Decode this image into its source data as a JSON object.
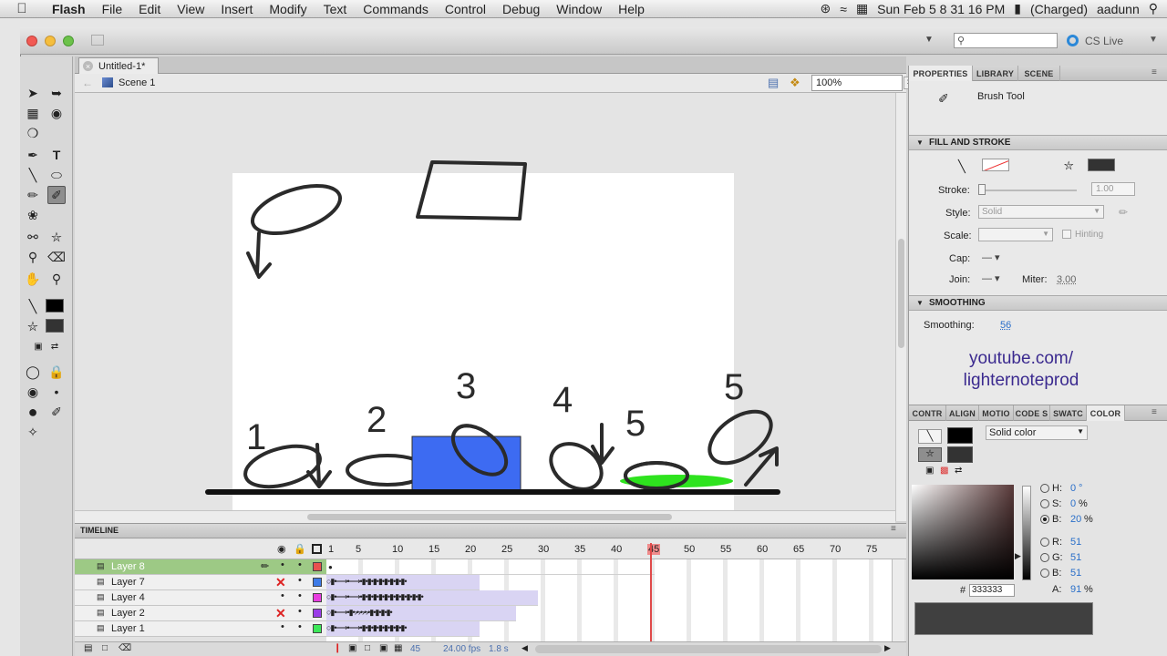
{
  "menubar": {
    "app_name": "Flash",
    "items": [
      "File",
      "Edit",
      "View",
      "Insert",
      "Modify",
      "Text",
      "Commands",
      "Control",
      "Debug",
      "Window",
      "Help"
    ],
    "clock": "Sun Feb 5  8 31 16 PM",
    "battery": "(Charged)",
    "user": "aadunn"
  },
  "toolbar": {
    "cs_live": "CS Live"
  },
  "document": {
    "tab_title": "Untitled-1*",
    "scene": "Scene 1",
    "zoom": "100%"
  },
  "stage_labels": {
    "n1": "1",
    "n2": "2",
    "n3": "3",
    "n4": "4",
    "n5a": "5",
    "n5b": "5"
  },
  "timeline": {
    "title": "TIMELINE",
    "frame_numbers": [
      "1",
      "5",
      "10",
      "15",
      "20",
      "25",
      "30",
      "35",
      "40",
      "45",
      "50",
      "55",
      "60",
      "65",
      "70",
      "75"
    ],
    "layers": [
      {
        "name": "Layer 8",
        "color": "#e8524f",
        "selected": true
      },
      {
        "name": "Layer 7",
        "color": "#3d7be8",
        "selected": false
      },
      {
        "name": "Layer 4",
        "color": "#e83de0",
        "selected": false
      },
      {
        "name": "Layer 2",
        "color": "#9a3de8",
        "selected": false
      },
      {
        "name": "Layer 1",
        "color": "#3de85a",
        "selected": false
      }
    ],
    "current_frame": "45",
    "fps": "24.00 fps",
    "time": "1.8 s"
  },
  "properties": {
    "tabs": [
      "PROPERTIES",
      "LIBRARY",
      "SCENE"
    ],
    "tool_name": "Brush Tool",
    "fill_stroke_title": "FILL AND STROKE",
    "stroke_label": "Stroke:",
    "stroke_value": "1.00",
    "style_label": "Style:",
    "style_value": "Solid",
    "scale_label": "Scale:",
    "hinting_label": "Hinting",
    "cap_label": "Cap:",
    "join_label": "Join:",
    "miter_label": "Miter:",
    "miter_value": "3.00",
    "smoothing_title": "SMOOTHING",
    "smoothing_label": "Smoothing:",
    "smoothing_value": "56"
  },
  "watermark": {
    "line1": "youtube.com/",
    "line2": "lighternoteprod"
  },
  "color_panel": {
    "tabs": [
      "CONTR",
      "ALIGN",
      "MOTIO",
      "CODE S",
      "SWATC",
      "COLOR"
    ],
    "type": "Solid color",
    "h_label": "H:",
    "h_value": "0",
    "h_unit": "°",
    "s_label": "S:",
    "s_value": "0",
    "s_unit": "%",
    "b_label": "B:",
    "b_value": "20",
    "b_unit": "%",
    "r_label": "R:",
    "r_value": "51",
    "g_label": "G:",
    "g_value": "51",
    "bb_label": "B:",
    "bb_value": "51",
    "hex_prefix": "#",
    "hex": "333333",
    "alpha_label": "A:",
    "alpha_value": "91",
    "alpha_unit": "%"
  },
  "colors": {
    "fill_swatch": "#333333",
    "stroke_swatch": "#000000",
    "blue_rect": "#3d6bf2",
    "green_blob": "#2ee31e",
    "layer_selected": "#9dc985"
  }
}
